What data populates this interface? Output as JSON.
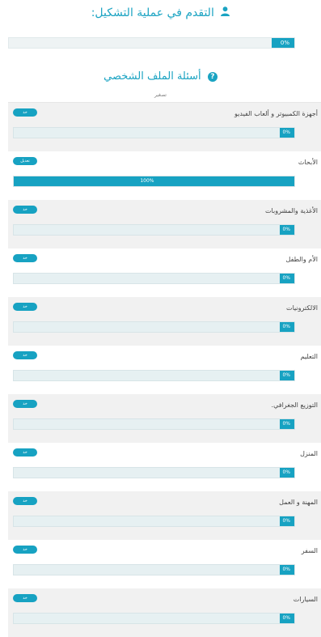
{
  "header": {
    "title": "التقدم في عملية التشكيل:",
    "icon": "user-icon",
    "progress_label": "0%",
    "progress_value": 0
  },
  "profile": {
    "title": "أسئلة الملف الشخصي",
    "icon": "question-circle-icon",
    "hint": "تصغير"
  },
  "colors": {
    "accent": "#17a2c2",
    "shade": "#f1f1f1",
    "track": "#e6f0f2"
  },
  "rows": [
    {
      "label": "أجهزة الكمبيوتر و ألعاب الفيديو",
      "button": "خذ",
      "percent_label": "0%",
      "value": 0
    },
    {
      "label": "الأبحاث",
      "button": "تعديل",
      "percent_label": "100%",
      "value": 100
    },
    {
      "label": "الأغذية والمشروبات",
      "button": "خذ",
      "percent_label": "0%",
      "value": 0
    },
    {
      "label": "الأم والطفل",
      "button": "خذ",
      "percent_label": "0%",
      "value": 0
    },
    {
      "label": "الالكترونيات",
      "button": "خذ",
      "percent_label": "0%",
      "value": 0
    },
    {
      "label": "التعليم",
      "button": "خذ",
      "percent_label": "0%",
      "value": 0
    },
    {
      "label": "التوزيع الجغرافي.",
      "button": "خذ",
      "percent_label": "0%",
      "value": 0
    },
    {
      "label": "المنزل",
      "button": "خذ",
      "percent_label": "0%",
      "value": 0
    },
    {
      "label": "المهنة و العمل",
      "button": "خذ",
      "percent_label": "0%",
      "value": 0
    },
    {
      "label": "السفر",
      "button": "خذ",
      "percent_label": "0%",
      "value": 0
    },
    {
      "label": "السيارات",
      "button": "خذ",
      "percent_label": "0%",
      "value": 0
    }
  ]
}
